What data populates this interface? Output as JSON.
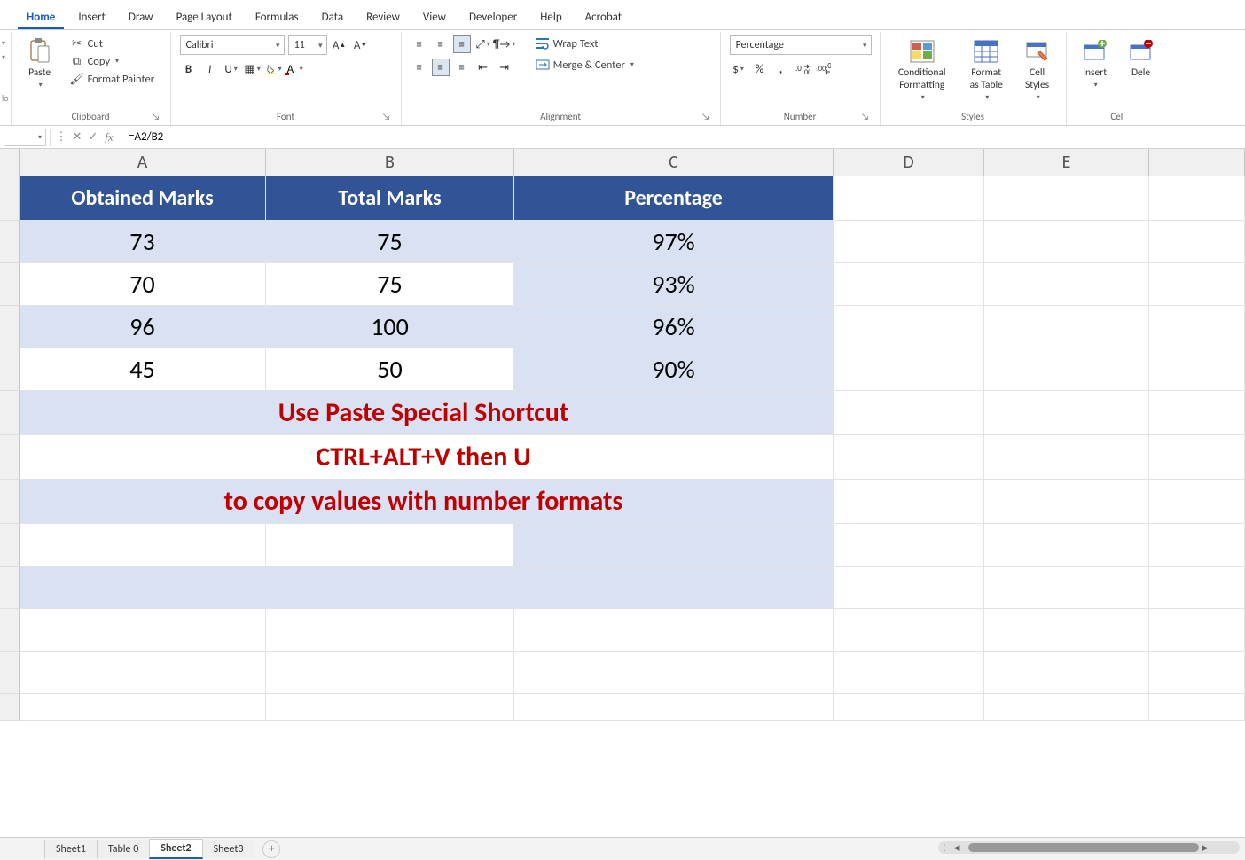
{
  "tabs": [
    "Home",
    "Insert",
    "Draw",
    "Page Layout",
    "Formulas",
    "Data",
    "Review",
    "View",
    "Developer",
    "Help",
    "Acrobat"
  ],
  "active_tab": "Home",
  "ribbon": {
    "clipboard": {
      "label": "Clipboard",
      "paste": "Paste",
      "cut": "Cut",
      "copy": "Copy",
      "format_painter": "Format Painter"
    },
    "font": {
      "label": "Font",
      "name": "Calibri",
      "size": "11"
    },
    "alignment": {
      "label": "Alignment",
      "wrap": "Wrap Text",
      "merge": "Merge & Center"
    },
    "number": {
      "label": "Number",
      "format": "Percentage"
    },
    "styles": {
      "label": "Styles",
      "cond": "Conditional Formatting",
      "table": "Format as Table",
      "cell": "Cell Styles"
    },
    "cells": {
      "label": "Cell",
      "insert": "Insert",
      "delete": "Dele"
    }
  },
  "formula_bar": {
    "formula": "=A2/B2"
  },
  "columns": [
    "A",
    "B",
    "C",
    "D",
    "E",
    ""
  ],
  "headers": [
    "Obtained Marks",
    "Total Marks",
    "Percentage"
  ],
  "data_rows": [
    {
      "a": "73",
      "b": "75",
      "c": "97%"
    },
    {
      "a": "70",
      "b": "75",
      "c": "93%"
    },
    {
      "a": "96",
      "b": "100",
      "c": "96%"
    },
    {
      "a": "45",
      "b": "50",
      "c": "90%"
    }
  ],
  "messages": [
    "Use Paste Special Shortcut",
    "CTRL+ALT+V then U",
    "to copy values with number formats"
  ],
  "sheets": [
    "Sheet1",
    "Table 0",
    "Sheet2",
    "Sheet3"
  ],
  "active_sheet": "Sheet2"
}
